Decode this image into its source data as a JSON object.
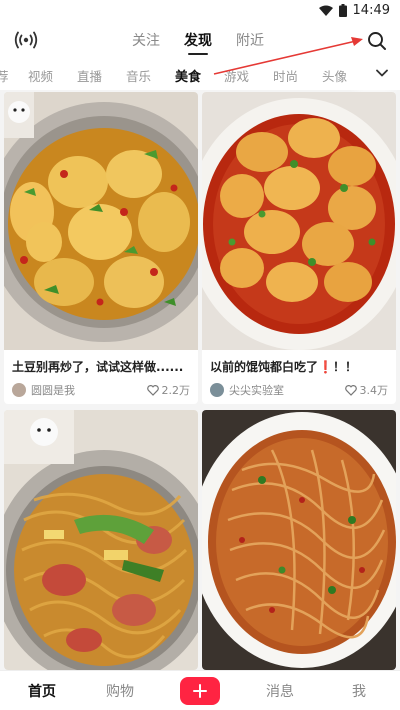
{
  "status": {
    "time": "14:49"
  },
  "top_nav": {
    "tabs": [
      {
        "label": "关注"
      },
      {
        "label": "发现",
        "active": true
      },
      {
        "label": "附近"
      }
    ],
    "live_icon": "live-broadcast-icon",
    "search_icon": "search-icon"
  },
  "categories": {
    "items": [
      "荐",
      "视频",
      "直播",
      "音乐",
      "美食",
      "游戏",
      "时尚",
      "头像"
    ],
    "active": "美食",
    "more_icon": "chevron-down-icon"
  },
  "feed": {
    "cards": [
      {
        "title": "土豆别再炒了，试试这样做......",
        "author": "圆圆是我",
        "likes": "2.2万",
        "image": "potato-dish"
      },
      {
        "title": "以前的馄饨都白吃了❗！！",
        "author": "尖尖实验室",
        "likes": "3.4万",
        "image": "wonton-chili-oil"
      },
      {
        "title": "",
        "author": "",
        "likes": "",
        "image": "fried-noodles-sausage"
      },
      {
        "title": "",
        "author": "",
        "likes": "",
        "image": "spicy-noodles-bowl"
      }
    ]
  },
  "bottom_nav": {
    "home": "首页",
    "shop": "购物",
    "messages": "消息",
    "me": "我"
  },
  "colors": {
    "brand": "#ff2442",
    "annotation": "#e53935"
  }
}
